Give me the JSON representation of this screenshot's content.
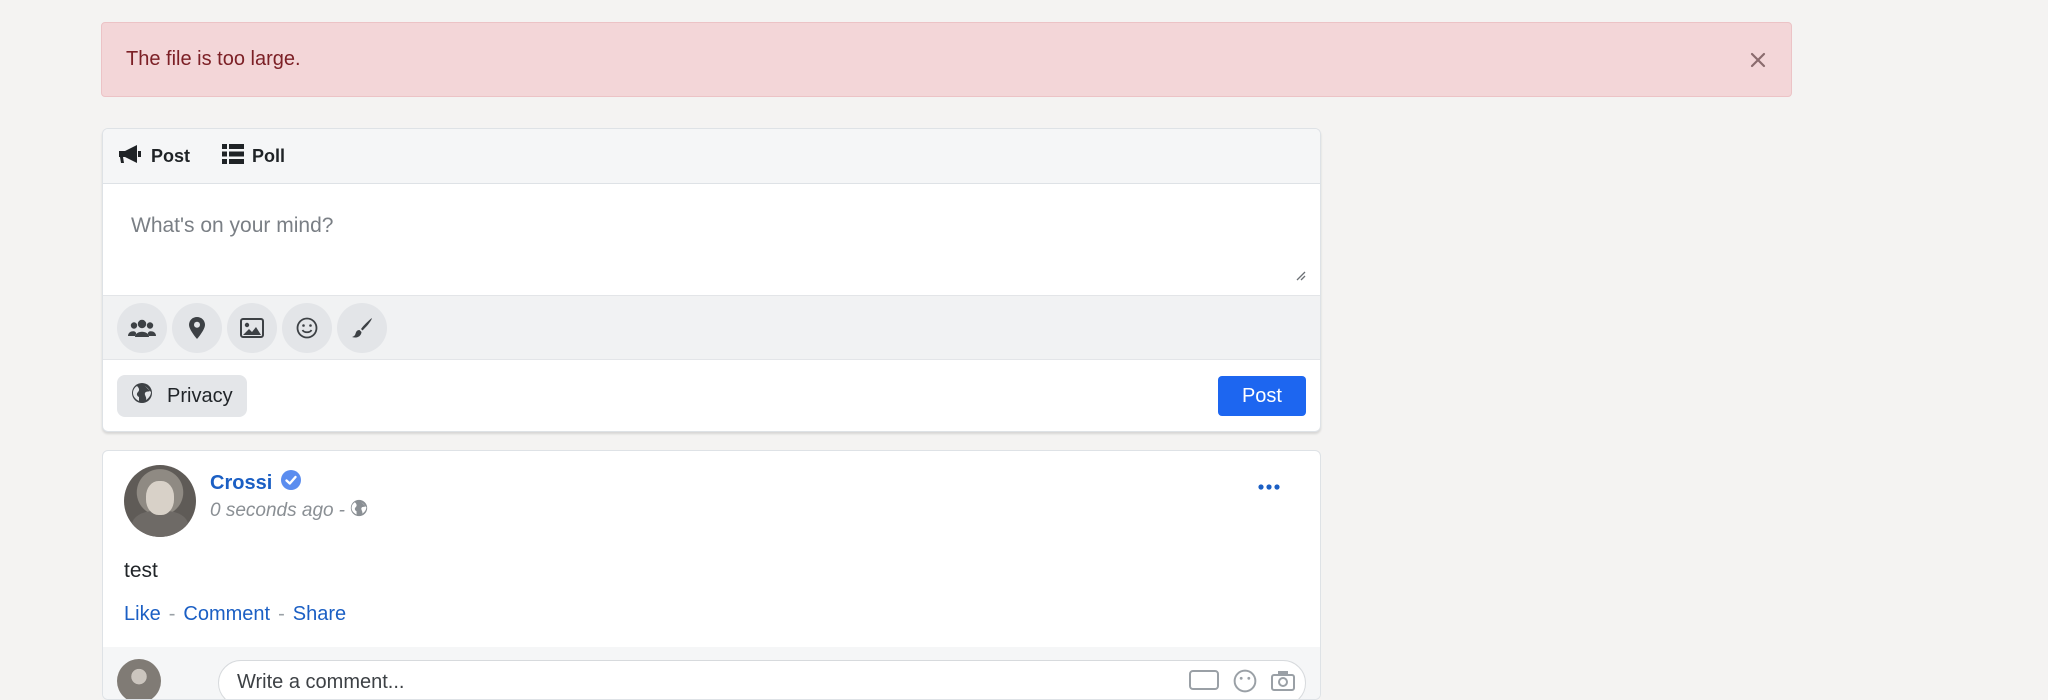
{
  "alert": {
    "message": "The file is too large.",
    "close_icon": "close-icon"
  },
  "composer": {
    "tabs": [
      {
        "label": "Post",
        "icon": "megaphone-icon"
      },
      {
        "label": "Poll",
        "icon": "list-icon"
      }
    ],
    "placeholder": "What's on your mind?",
    "tools": [
      "users-icon",
      "location-pin-icon",
      "image-icon",
      "smiley-icon",
      "paintbrush-icon"
    ],
    "privacy_label": "Privacy",
    "post_label": "Post"
  },
  "post": {
    "author": "Crossi",
    "verified": true,
    "time": "0 seconds ago",
    "separator": "-",
    "body": "test",
    "actions": [
      "Like",
      "Comment",
      "Share"
    ],
    "comment_placeholder": "Write a comment..."
  },
  "colors": {
    "alert_bg": "#f3d6d8",
    "alert_text": "#7c2026",
    "link": "#1b5fc4",
    "primary_button": "#1d66f0",
    "page_bg": "#f4f3f2"
  }
}
